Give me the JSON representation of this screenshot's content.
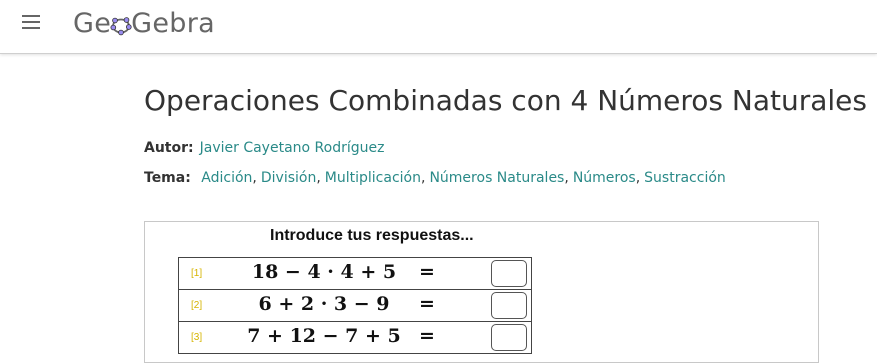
{
  "header": {
    "logo_text_pre": "Ge",
    "logo_text_post": "Gebra",
    "menu_icon": "hamburger-menu-icon",
    "logo_icon": "geogebra-ring-icon"
  },
  "page": {
    "title": "Operaciones Combinadas con 4 Números Naturales",
    "author_label": "Autor:",
    "author": "Javier Cayetano Rodríguez",
    "topic_label": "Tema:",
    "topics": [
      "Adición",
      "División",
      "Multiplicación",
      "Números Naturales",
      "Números",
      "Sustracción"
    ],
    "topic_separator": ","
  },
  "applet": {
    "instruction": "Introduce tus respuestas...",
    "rows": [
      {
        "num": "[1]",
        "expr": "18 − 4 · 4 + 5",
        "eq": "=",
        "answer": ""
      },
      {
        "num": "[2]",
        "expr": "6 + 2 · 3 − 9",
        "eq": "=",
        "answer": ""
      },
      {
        "num": "[3]",
        "expr": "7 + 12 − 7 + 5",
        "eq": "=",
        "answer": ""
      }
    ]
  },
  "colors": {
    "link": "#2a8a88",
    "row_number": "#d6b400",
    "logo_ring": "#6a5acd"
  }
}
